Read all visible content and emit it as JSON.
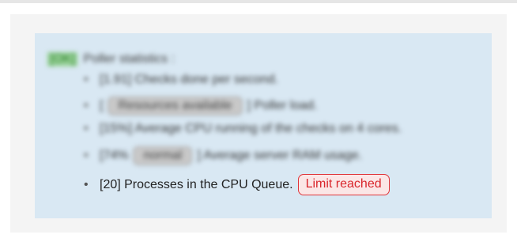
{
  "poller": {
    "status_tag": "[OK]",
    "header_label": "Poller statistics :",
    "items": [
      {
        "bullet": "•",
        "text": "[1.91] Checks done per second."
      },
      {
        "bullet": "•",
        "prefix": "[",
        "badge": "Resources available",
        "suffix": "] Poller load."
      },
      {
        "bullet": "•",
        "text": "[15%] Average CPU running of the checks on 4 cores."
      },
      {
        "bullet": "•",
        "prefix": "[74%",
        "badge": "normal",
        "suffix": "] Average server RAM usage."
      },
      {
        "bullet": "•",
        "text": "[20] Processes in the CPU Queue.",
        "badge": "Limit reached"
      }
    ]
  },
  "colors": {
    "panel_bg": "#d9e8f3",
    "outer_bg": "#f4f4f4",
    "ok_tag": "#9ad49a",
    "limit_badge_border": "#e0353a",
    "limit_badge_text": "#d9262c"
  }
}
